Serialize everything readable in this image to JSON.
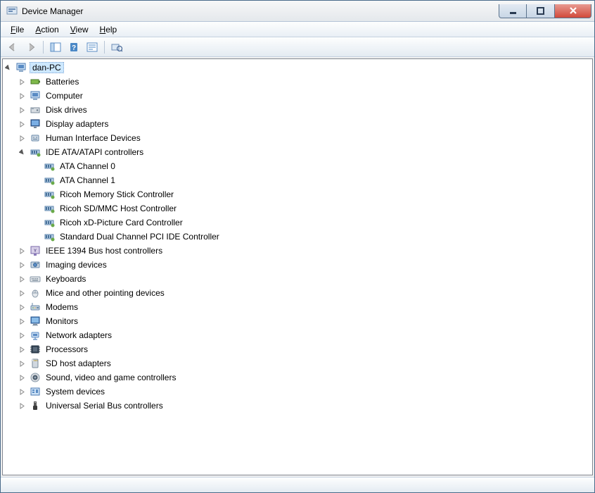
{
  "window": {
    "title": "Device Manager"
  },
  "menu": {
    "file": "File",
    "action": "Action",
    "view": "View",
    "help": "Help"
  },
  "tree": {
    "root": {
      "label": "dan-PC",
      "icon": "computer-icon",
      "expanded": true
    },
    "categories": [
      {
        "label": "Batteries",
        "icon": "battery-icon",
        "expanded": false
      },
      {
        "label": "Computer",
        "icon": "computer-icon",
        "expanded": false
      },
      {
        "label": "Disk drives",
        "icon": "disk-icon",
        "expanded": false
      },
      {
        "label": "Display adapters",
        "icon": "display-icon",
        "expanded": false
      },
      {
        "label": "Human Interface Devices",
        "icon": "hid-icon",
        "expanded": false
      },
      {
        "label": "IDE ATA/ATAPI controllers",
        "icon": "ide-icon",
        "expanded": true,
        "children": [
          {
            "label": "ATA Channel 0",
            "icon": "ide-icon"
          },
          {
            "label": "ATA Channel 1",
            "icon": "ide-icon"
          },
          {
            "label": "Ricoh Memory Stick Controller",
            "icon": "ide-icon"
          },
          {
            "label": "Ricoh SD/MMC Host Controller",
            "icon": "ide-icon"
          },
          {
            "label": "Ricoh xD-Picture Card Controller",
            "icon": "ide-icon"
          },
          {
            "label": "Standard Dual Channel PCI IDE Controller",
            "icon": "ide-icon"
          }
        ]
      },
      {
        "label": "IEEE 1394 Bus host controllers",
        "icon": "firewire-icon",
        "expanded": false
      },
      {
        "label": "Imaging devices",
        "icon": "imaging-icon",
        "expanded": false
      },
      {
        "label": "Keyboards",
        "icon": "keyboard-icon",
        "expanded": false
      },
      {
        "label": "Mice and other pointing devices",
        "icon": "mouse-icon",
        "expanded": false
      },
      {
        "label": "Modems",
        "icon": "modem-icon",
        "expanded": false
      },
      {
        "label": "Monitors",
        "icon": "monitor2-icon",
        "expanded": false
      },
      {
        "label": "Network adapters",
        "icon": "network-icon",
        "expanded": false
      },
      {
        "label": "Processors",
        "icon": "processor-icon",
        "expanded": false
      },
      {
        "label": "SD host adapters",
        "icon": "sd-icon",
        "expanded": false
      },
      {
        "label": "Sound, video and game controllers",
        "icon": "sound-icon",
        "expanded": false
      },
      {
        "label": "System devices",
        "icon": "system-icon",
        "expanded": false
      },
      {
        "label": "Universal Serial Bus controllers",
        "icon": "usb-icon",
        "expanded": false
      }
    ]
  }
}
